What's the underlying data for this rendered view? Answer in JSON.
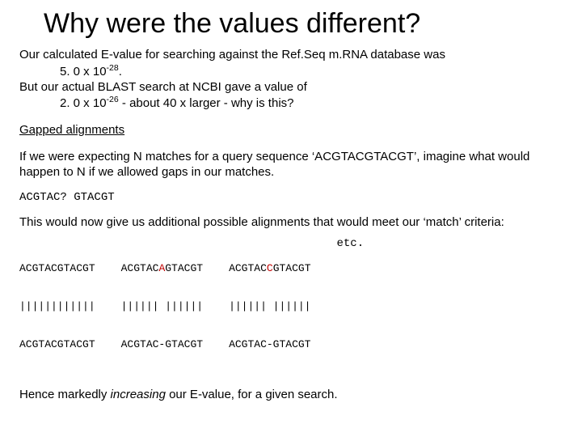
{
  "title": "Why were the values different?",
  "p1_a": "Our calculated E-value for searching against the Ref.Seq m.RNA database was",
  "p1_b_pre": "5. 0 x 10",
  "p1_b_exp": "-28",
  "p1_b_post": ".",
  "p1_c": "But our actual BLAST search at NCBI gave a value of",
  "p1_d_pre": "2. 0 x 10",
  "p1_d_exp": "-26",
  "p1_d_post": "   - about 40 x larger - why is this?",
  "gapped": "Gapped alignments",
  "p2": "If we were expecting N matches for a query sequence ‘ACGTACGTACGT’, imagine what would happen to N if we allowed gaps in our matches.",
  "seq1": "ACGTAC? GTACGT",
  "p3": "This would now give us additional possible alignments that would meet our ‘match’ criteria:",
  "col1_l1": "ACGTACGTACGT",
  "col1_l2": "||||||||||||",
  "col1_l3": "ACGTACGTACGT",
  "col2_l1a": "ACGTAC",
  "col2_l1b": "A",
  "col2_l1c": "GTACGT",
  "col2_l2": "|||||| ||||||",
  "col2_l3": "ACGTAC-GTACGT",
  "col3_l1a": "ACGTAC",
  "col3_l1b": "C",
  "col3_l1c": "GTACGT",
  "col3_l2": "|||||| ||||||",
  "col3_l3": "ACGTAC-GTACGT",
  "etc": "etc.",
  "p4_a": "Hence markedly ",
  "p4_b": "increasing",
  "p4_c": " our E-value, for a given search."
}
